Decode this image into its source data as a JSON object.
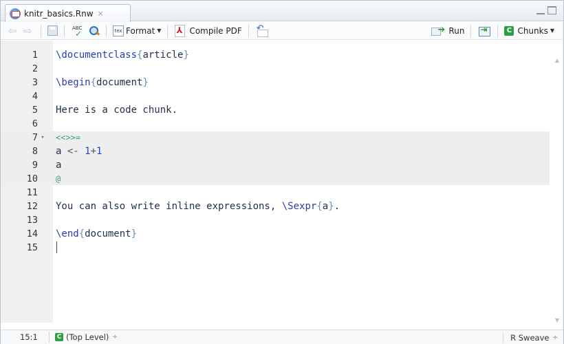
{
  "tab": {
    "filename": "knitr_basics.Rnw",
    "close_glyph": "×"
  },
  "toolbar": {
    "spell_abc": "ABC",
    "spell_check": "✓",
    "tex_icon_text": "tex",
    "format_label": "Format",
    "compile_label": "Compile PDF",
    "run_label": "Run",
    "chunks_label": "Chunks",
    "chunks_badge": "C",
    "icons": [
      "back-arrow-icon",
      "forward-arrow-icon",
      "save-icon",
      "spellcheck-icon",
      "search-icon",
      "tex-icon",
      "pdf-icon",
      "sync-pdf-icon",
      "run-icon",
      "rerun-icon",
      "chunk-icon"
    ]
  },
  "editor": {
    "lines": [
      {
        "n": "1",
        "parts": [
          [
            "kw",
            "\\documentclass"
          ],
          [
            "brace",
            "{"
          ],
          [
            "arg",
            "article"
          ],
          [
            "brace",
            "}"
          ]
        ]
      },
      {
        "n": "2",
        "parts": []
      },
      {
        "n": "3",
        "parts": [
          [
            "kw",
            "\\begin"
          ],
          [
            "brace",
            "{"
          ],
          [
            "arg",
            "document"
          ],
          [
            "brace",
            "}"
          ]
        ]
      },
      {
        "n": "4",
        "parts": []
      },
      {
        "n": "5",
        "parts": [
          [
            "tx",
            "Here is a code chunk."
          ]
        ]
      },
      {
        "n": "6",
        "parts": []
      },
      {
        "n": "7",
        "fold": "▾",
        "parts": [
          [
            "chunkmark",
            "<<>>="
          ]
        ]
      },
      {
        "n": "8",
        "parts": [
          [
            "tx",
            "a "
          ],
          [
            "op",
            "<-"
          ],
          [
            "tx",
            " "
          ],
          [
            "num",
            "1"
          ],
          [
            "op",
            "+"
          ],
          [
            "num",
            "1"
          ]
        ]
      },
      {
        "n": "9",
        "parts": [
          [
            "tx",
            "a"
          ]
        ]
      },
      {
        "n": "10",
        "parts": [
          [
            "chunkmark",
            "@"
          ]
        ]
      },
      {
        "n": "11",
        "parts": []
      },
      {
        "n": "12",
        "parts": [
          [
            "tx",
            "You can also write inline expressions, "
          ],
          [
            "kw",
            "\\Sexpr"
          ],
          [
            "brace",
            "{"
          ],
          [
            "arg",
            "a"
          ],
          [
            "brace",
            "}"
          ],
          [
            "tx",
            "."
          ]
        ]
      },
      {
        "n": "13",
        "parts": []
      },
      {
        "n": "14",
        "parts": [
          [
            "kw",
            "\\end"
          ],
          [
            "brace",
            "{"
          ],
          [
            "arg",
            "document"
          ],
          [
            "brace",
            "}"
          ]
        ]
      },
      {
        "n": "15",
        "parts": []
      }
    ],
    "chunk_lines": [
      "7",
      "8",
      "9",
      "10"
    ]
  },
  "status": {
    "position": "15:1",
    "scope_badge": "C",
    "scope": "(Top Level)",
    "scope_arrows": "÷",
    "filetype": "R Sweave",
    "filetype_arrows": "÷"
  },
  "colors": {
    "keyword": "#2a3bb5",
    "chunk_marker": "#3f9e74",
    "chunk_badge": "#2f9e46",
    "chunk_background": "#eeeeee"
  }
}
